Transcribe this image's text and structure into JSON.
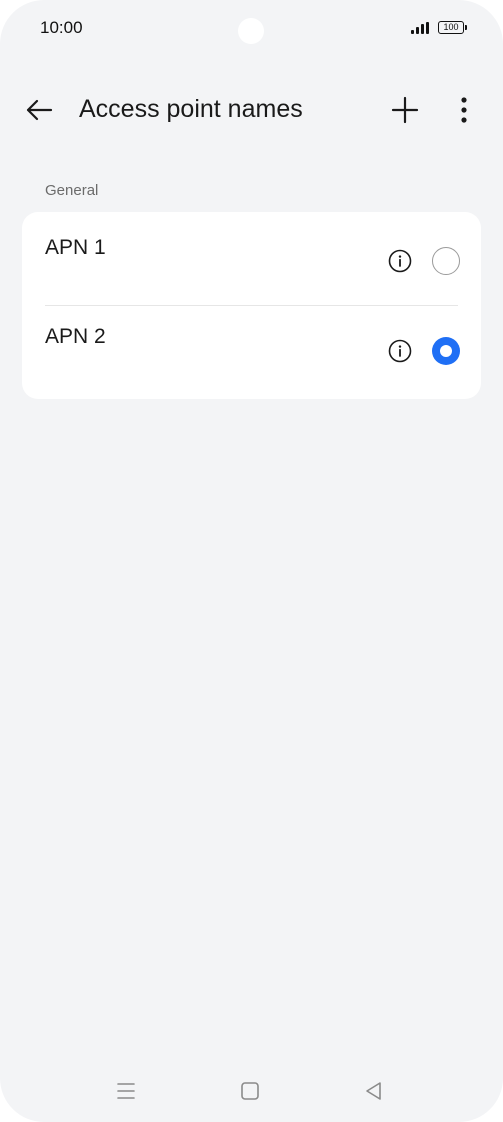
{
  "status_bar": {
    "time": "10:00",
    "battery": "100"
  },
  "header": {
    "title": "Access point names",
    "back_icon": "arrow-left-icon",
    "add_icon": "plus-icon",
    "more_icon": "more-vertical-icon"
  },
  "section": {
    "label": "General"
  },
  "apns": [
    {
      "label": "APN 1",
      "selected": false
    },
    {
      "label": "APN 2",
      "selected": true
    }
  ],
  "colors": {
    "accent": "#1f6ff5",
    "background": "#f3f4f6",
    "card": "#ffffff"
  },
  "nav_bar": {
    "icons": [
      "menu-icon",
      "home-icon",
      "back-triangle-icon"
    ]
  }
}
